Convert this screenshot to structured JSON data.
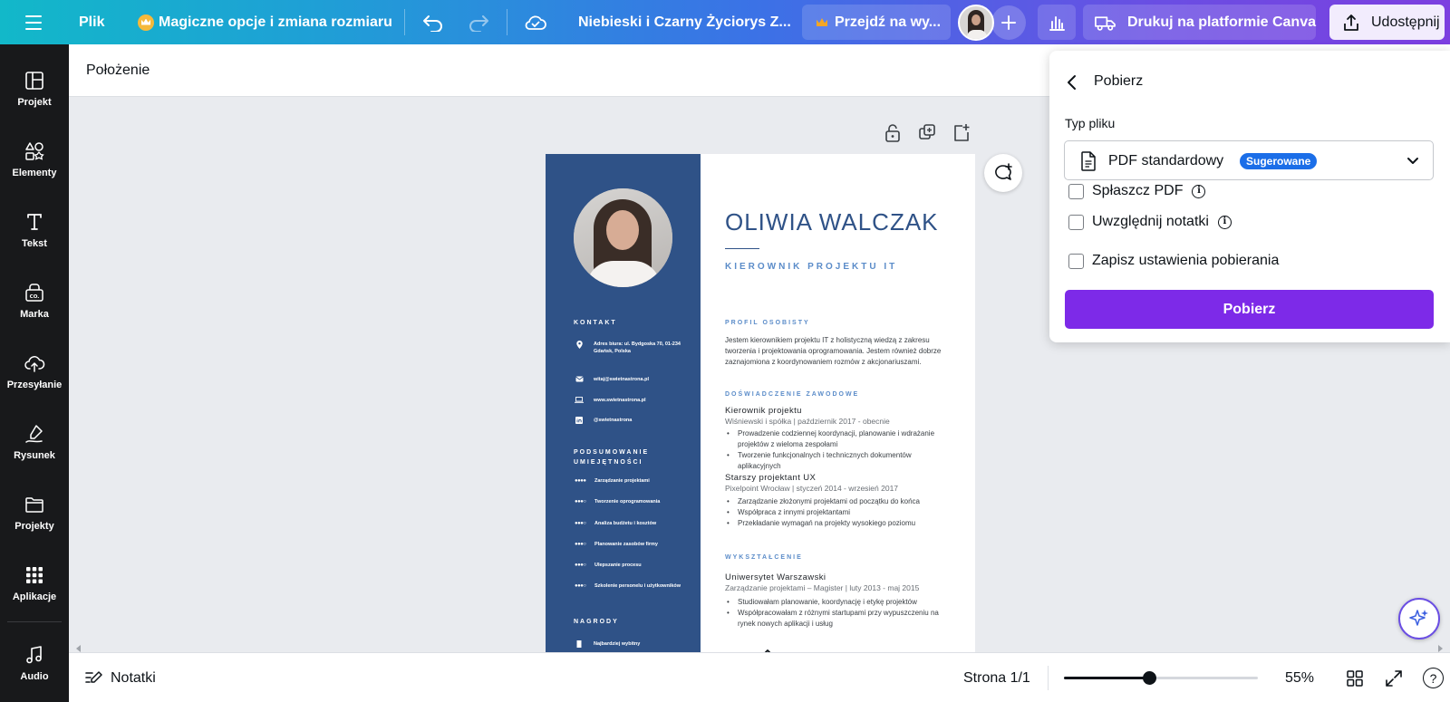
{
  "topbar": {
    "file_menu": "Plik",
    "magic_resize": "Magiczne opcje i zmiana rozmiaru",
    "doc_title": "Niebieski i Czarny Życiorys Z...",
    "upgrade": "Przejdź na wy...",
    "print": "Drukuj na platformie Canva",
    "share": "Udostępnij"
  },
  "sidebar": {
    "items": [
      {
        "label": "Projekt",
        "icon": "layout-icon"
      },
      {
        "label": "Elementy",
        "icon": "shapes-icon"
      },
      {
        "label": "Tekst",
        "icon": "text-icon"
      },
      {
        "label": "Marka",
        "icon": "brand-icon"
      },
      {
        "label": "Przesyłanie",
        "icon": "upload-cloud-icon"
      },
      {
        "label": "Rysunek",
        "icon": "draw-icon"
      },
      {
        "label": "Projekty",
        "icon": "folder-icon"
      },
      {
        "label": "Aplikacje",
        "icon": "apps-grid-icon"
      },
      {
        "label": "Audio",
        "icon": "music-note-icon"
      }
    ]
  },
  "position_header": {
    "label": "Położenie"
  },
  "resume": {
    "name": "OLIWIA WALCZAK",
    "role": "KIEROWNIK PROJEKTU IT",
    "contact_heading": "KONTAKT",
    "address": "Adres biura: ul. Bydgoska 70, 01-234 Gdańsk, Polska",
    "email": "witaj@swietnastrona.pl",
    "website": "www.swietnastrona.pl",
    "social": "@swietnastrona",
    "skills_heading": "PODSUMOWANIE UMIEJĘTNOŚCI",
    "skills": [
      "Zarządzanie projektami",
      "Tworzenie oprogramowania",
      "Analiza budżetu i kosztów",
      "Planowanie zasobów firmy",
      "Ulepszanie procesu",
      "Szkolenie personelu i użytkowników"
    ],
    "awards_heading": "NAGRODY",
    "award_1": "Najbardziej wybitny",
    "profile_heading": "PROFIL OSOBISTY",
    "profile_text": "Jestem kierownikiem projektu IT z holistyczną wiedzą z zakresu tworzenia i projektowania oprogramowania. Jestem również dobrze zaznajomiona z koordynowaniem rozmów z akcjonariuszami.",
    "experience_heading": "DOŚWIADCZENIE ZAWODOWE",
    "job1_title": "Kierownik projektu",
    "job1_meta": "Wiśniewski i spółka | październik 2017 - obecnie",
    "job1_bullets": [
      "Prowadzenie codziennej koordynacji, planowanie i wdrażanie projektów z wieloma zespołami",
      "Tworzenie funkcjonalnych i technicznych dokumentów aplikacyjnych"
    ],
    "job2_title": "Starszy projektant UX",
    "job2_meta": "Pixelpoint Wrocław | styczeń 2014 - wrzesień 2017",
    "job2_bullets": [
      "Zarządzanie złożonymi projektami od początku do końca",
      "Współpraca z innymi projektantami",
      "Przekładanie wymagań na projekty wysokiego poziomu"
    ],
    "education_heading": "WYKSZTAŁCENIE",
    "edu_school": "Uniwersytet Warszawski",
    "edu_meta": "Zarządzanie projektami – Magister | luty 2013 - maj 2015",
    "edu_bullets": [
      "Studiowałam planowanie, koordynację i etykę projektów",
      "Współpracowałam z różnymi startupami przy wypuszczeniu na rynek nowych aplikacji i usług"
    ]
  },
  "download_panel": {
    "title": "Pobierz",
    "file_type_label": "Typ pliku",
    "file_type_value": "PDF standardowy",
    "suggested_badge": "Sugerowane",
    "flatten_pdf": "Spłaszcz PDF",
    "include_notes": "Uwzględnij notatki",
    "save_settings": "Zapisz ustawienia pobierania",
    "download_button": "Pobierz"
  },
  "bottombar": {
    "notes": "Notatki",
    "page_indicator": "Strona 1/1",
    "zoom": "55%",
    "zoom_fraction": 0.44,
    "help": "?"
  },
  "colors": {
    "sidebar_bg": "#18191b",
    "resume_blue": "#2f5287",
    "accent_purple": "#7d2ae8",
    "badge_blue": "#1b6ee8"
  }
}
